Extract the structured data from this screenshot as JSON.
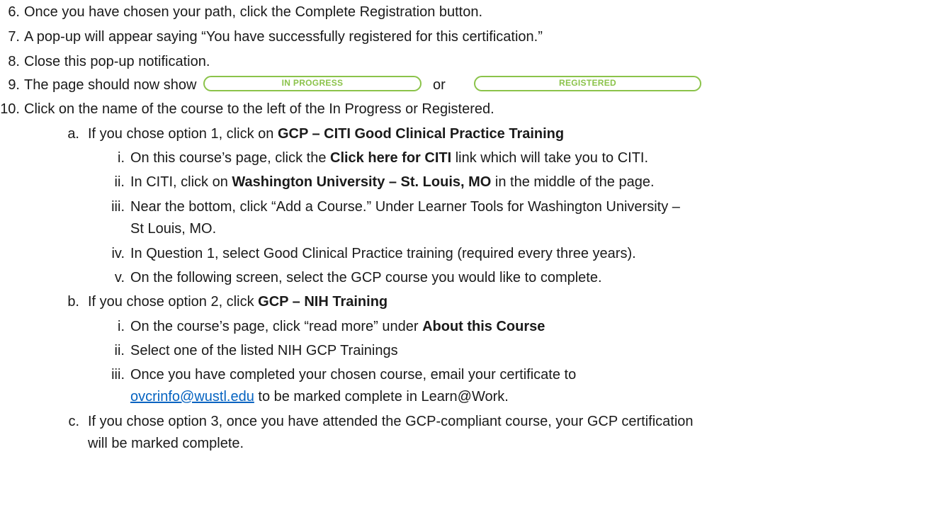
{
  "steps": [
    {
      "num": "6.",
      "text": "Once you have chosen your path, click the Complete Registration button."
    },
    {
      "num": "7.",
      "text": "A pop-up will appear saying “You have successfully registered for this certification.”"
    },
    {
      "num": "8.",
      "text": "Close this pop-up notification."
    },
    {
      "num": "9.",
      "text": "The page should now show",
      "or": "or",
      "badge1": "IN PROGRESS",
      "badge2": "REGISTERED"
    },
    {
      "num": "10.",
      "text": "Click on the name of the course to the left of the In Progress or Registered."
    }
  ],
  "option_a": {
    "letter": "a.",
    "pre": "If you chose option 1, click on ",
    "bold": "GCP – CITI Good Clinical Practice Training",
    "items": [
      {
        "num": "i.",
        "pre": "On this course’s page, click the ",
        "bold": "Click here for CITI",
        "post": " link which will take you to CITI."
      },
      {
        "num": "ii.",
        "pre": "In CITI, click on ",
        "bold": "Washington University – St. Louis, MO",
        "post": " in the middle of the page."
      },
      {
        "num": "iii.",
        "line1": "Near the bottom, click “Add a Course.” Under Learner Tools for Washington University –",
        "line2": "St Louis, MO."
      },
      {
        "num": "iv.",
        "text": "In Question 1, select Good Clinical Practice training (required every three years)."
      },
      {
        "num": "v.",
        "text": "On the following screen, select the GCP course you would like to complete."
      }
    ]
  },
  "option_b": {
    "letter": "b.",
    "pre": "If you chose option 2, click ",
    "bold": "GCP – NIH Training",
    "items": [
      {
        "num": "i.",
        "pre": "On the course’s page, click “read more” under ",
        "bold": "About this Course"
      },
      {
        "num": "ii.",
        "text": "Select one of the listed NIH GCP Trainings"
      },
      {
        "num": "iii.",
        "line1": "Once you have completed your chosen course, email your certificate to",
        "link": "ovcrinfo@wustl.edu",
        "line2_post": " to be marked complete in Learn@Work."
      }
    ]
  },
  "option_c": {
    "letter": "c.",
    "line1": "If you chose option 3, once you have attended the GCP-compliant course, your GCP certification",
    "line2": "will be marked complete."
  },
  "colors": {
    "badge_green": "#8bc34a",
    "link_blue": "#0563c1"
  }
}
